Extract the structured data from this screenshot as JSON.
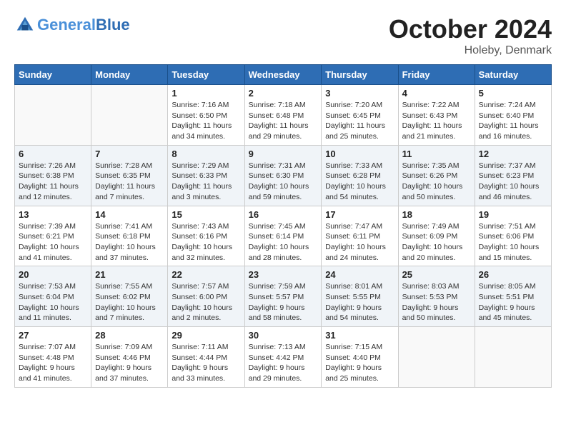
{
  "header": {
    "logo_line1": "General",
    "logo_line2": "Blue",
    "month": "October 2024",
    "location": "Holeby, Denmark"
  },
  "days_of_week": [
    "Sunday",
    "Monday",
    "Tuesday",
    "Wednesday",
    "Thursday",
    "Friday",
    "Saturday"
  ],
  "weeks": [
    [
      {
        "num": "",
        "info": ""
      },
      {
        "num": "",
        "info": ""
      },
      {
        "num": "1",
        "info": "Sunrise: 7:16 AM\nSunset: 6:50 PM\nDaylight: 11 hours and 34 minutes."
      },
      {
        "num": "2",
        "info": "Sunrise: 7:18 AM\nSunset: 6:48 PM\nDaylight: 11 hours and 29 minutes."
      },
      {
        "num": "3",
        "info": "Sunrise: 7:20 AM\nSunset: 6:45 PM\nDaylight: 11 hours and 25 minutes."
      },
      {
        "num": "4",
        "info": "Sunrise: 7:22 AM\nSunset: 6:43 PM\nDaylight: 11 hours and 21 minutes."
      },
      {
        "num": "5",
        "info": "Sunrise: 7:24 AM\nSunset: 6:40 PM\nDaylight: 11 hours and 16 minutes."
      }
    ],
    [
      {
        "num": "6",
        "info": "Sunrise: 7:26 AM\nSunset: 6:38 PM\nDaylight: 11 hours and 12 minutes."
      },
      {
        "num": "7",
        "info": "Sunrise: 7:28 AM\nSunset: 6:35 PM\nDaylight: 11 hours and 7 minutes."
      },
      {
        "num": "8",
        "info": "Sunrise: 7:29 AM\nSunset: 6:33 PM\nDaylight: 11 hours and 3 minutes."
      },
      {
        "num": "9",
        "info": "Sunrise: 7:31 AM\nSunset: 6:30 PM\nDaylight: 10 hours and 59 minutes."
      },
      {
        "num": "10",
        "info": "Sunrise: 7:33 AM\nSunset: 6:28 PM\nDaylight: 10 hours and 54 minutes."
      },
      {
        "num": "11",
        "info": "Sunrise: 7:35 AM\nSunset: 6:26 PM\nDaylight: 10 hours and 50 minutes."
      },
      {
        "num": "12",
        "info": "Sunrise: 7:37 AM\nSunset: 6:23 PM\nDaylight: 10 hours and 46 minutes."
      }
    ],
    [
      {
        "num": "13",
        "info": "Sunrise: 7:39 AM\nSunset: 6:21 PM\nDaylight: 10 hours and 41 minutes."
      },
      {
        "num": "14",
        "info": "Sunrise: 7:41 AM\nSunset: 6:18 PM\nDaylight: 10 hours and 37 minutes."
      },
      {
        "num": "15",
        "info": "Sunrise: 7:43 AM\nSunset: 6:16 PM\nDaylight: 10 hours and 32 minutes."
      },
      {
        "num": "16",
        "info": "Sunrise: 7:45 AM\nSunset: 6:14 PM\nDaylight: 10 hours and 28 minutes."
      },
      {
        "num": "17",
        "info": "Sunrise: 7:47 AM\nSunset: 6:11 PM\nDaylight: 10 hours and 24 minutes."
      },
      {
        "num": "18",
        "info": "Sunrise: 7:49 AM\nSunset: 6:09 PM\nDaylight: 10 hours and 20 minutes."
      },
      {
        "num": "19",
        "info": "Sunrise: 7:51 AM\nSunset: 6:06 PM\nDaylight: 10 hours and 15 minutes."
      }
    ],
    [
      {
        "num": "20",
        "info": "Sunrise: 7:53 AM\nSunset: 6:04 PM\nDaylight: 10 hours and 11 minutes."
      },
      {
        "num": "21",
        "info": "Sunrise: 7:55 AM\nSunset: 6:02 PM\nDaylight: 10 hours and 7 minutes."
      },
      {
        "num": "22",
        "info": "Sunrise: 7:57 AM\nSunset: 6:00 PM\nDaylight: 10 hours and 2 minutes."
      },
      {
        "num": "23",
        "info": "Sunrise: 7:59 AM\nSunset: 5:57 PM\nDaylight: 9 hours and 58 minutes."
      },
      {
        "num": "24",
        "info": "Sunrise: 8:01 AM\nSunset: 5:55 PM\nDaylight: 9 hours and 54 minutes."
      },
      {
        "num": "25",
        "info": "Sunrise: 8:03 AM\nSunset: 5:53 PM\nDaylight: 9 hours and 50 minutes."
      },
      {
        "num": "26",
        "info": "Sunrise: 8:05 AM\nSunset: 5:51 PM\nDaylight: 9 hours and 45 minutes."
      }
    ],
    [
      {
        "num": "27",
        "info": "Sunrise: 7:07 AM\nSunset: 4:48 PM\nDaylight: 9 hours and 41 minutes."
      },
      {
        "num": "28",
        "info": "Sunrise: 7:09 AM\nSunset: 4:46 PM\nDaylight: 9 hours and 37 minutes."
      },
      {
        "num": "29",
        "info": "Sunrise: 7:11 AM\nSunset: 4:44 PM\nDaylight: 9 hours and 33 minutes."
      },
      {
        "num": "30",
        "info": "Sunrise: 7:13 AM\nSunset: 4:42 PM\nDaylight: 9 hours and 29 minutes."
      },
      {
        "num": "31",
        "info": "Sunrise: 7:15 AM\nSunset: 4:40 PM\nDaylight: 9 hours and 25 minutes."
      },
      {
        "num": "",
        "info": ""
      },
      {
        "num": "",
        "info": ""
      }
    ]
  ]
}
